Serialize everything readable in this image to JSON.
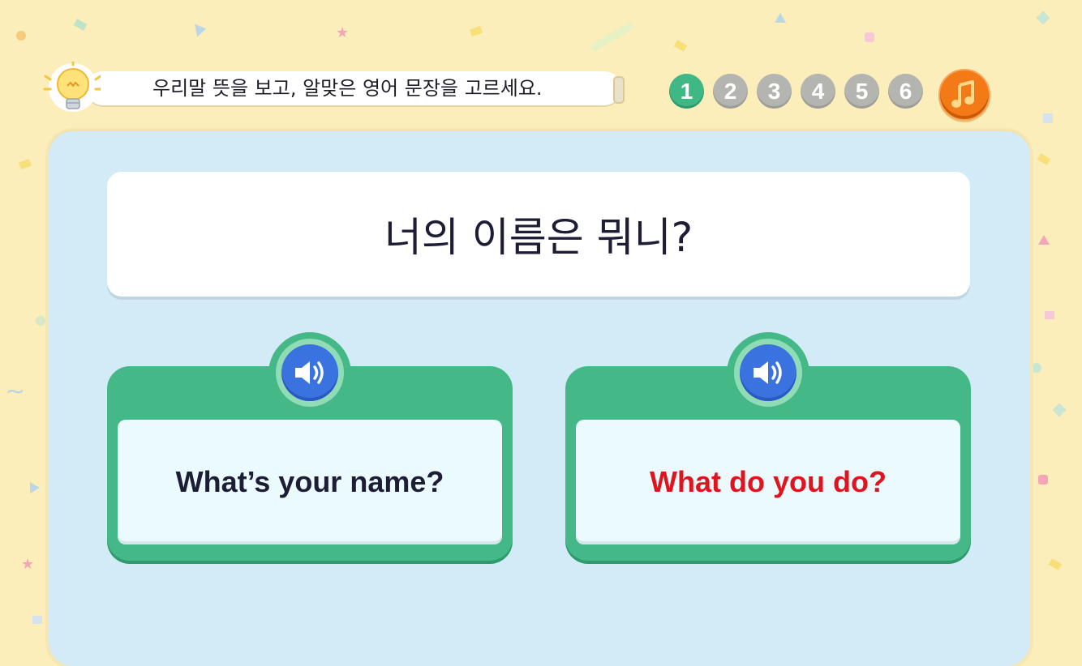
{
  "instruction": {
    "icon": "lightbulb-icon",
    "text": "우리말 뜻을 보고, 알맞은 영어 문장을 고르세요."
  },
  "steps": {
    "items": [
      "1",
      "2",
      "3",
      "4",
      "5",
      "6"
    ],
    "current": "1",
    "active_color": "#3fb886",
    "idle_color": "#b4b4b0"
  },
  "music_button": {
    "icon": "music-note-icon",
    "color": "#f37a16"
  },
  "question": {
    "text": "너의 이름은 뭐니?"
  },
  "options": [
    {
      "text": "What’s your name?",
      "color": "#1d1d36",
      "icon": "speaker-icon"
    },
    {
      "text": "What do you do?",
      "color": "#e0141e",
      "icon": "speaker-icon"
    }
  ],
  "colors": {
    "background": "#fbeebb",
    "panel": "#d2ebf6",
    "card": "#44b987",
    "speaker": "#3a73e0"
  }
}
